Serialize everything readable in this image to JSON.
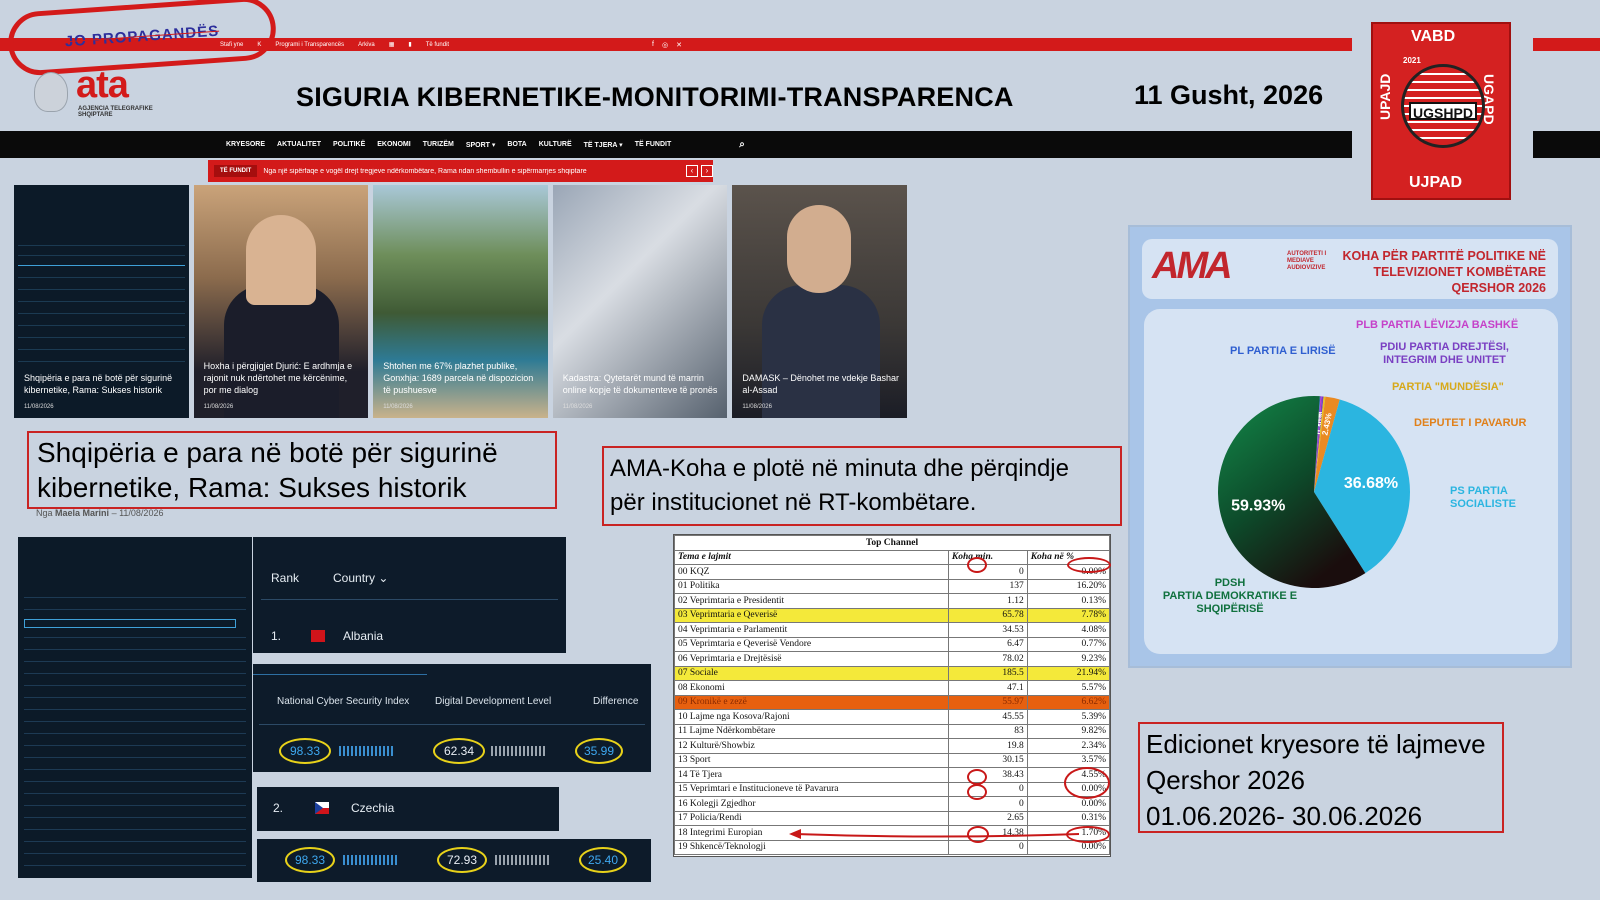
{
  "stamp": {
    "text": "JO PROPAGANDËS"
  },
  "site": {
    "logo_text": "ata",
    "logo_subtitle": "AGJENCIA TELEGRAFIKE SHQIPTARE",
    "top_links": [
      "Stafi yne",
      "K",
      "Programi i Transparencës",
      "Arkiva",
      "Të fundit"
    ],
    "social_icons": [
      "facebook-icon",
      "instagram-icon",
      "x-icon"
    ],
    "nav": [
      "KRYESORE",
      "AKTUALITET",
      "POLITIKË",
      "EKONOMI",
      "TURIZËM",
      "SPORT ▾",
      "BOTA",
      "KULTURË",
      "TË TJERA ▾",
      "TË FUNDIT"
    ],
    "ticker_tag": "TË FUNDIT",
    "ticker_text": "Nga një sipërfaqe e vogël drejt tregjeve ndërkombëtare, Rama ndan shembullin e sipërmarrjes shqiptare"
  },
  "headline": "SIGURIA KIBERNETIKE-MONITORIMI-TRANSPARENCA",
  "date": "11 Gusht, 2026",
  "badge": {
    "top": "VABD",
    "left": "UPAJD",
    "right": "UGAPD",
    "center": "UGSHPD",
    "bottom": "UJPAD",
    "year": "2021"
  },
  "cards": [
    {
      "caption": "Shqipëria e para në botë për sigurinë kibernetike, Rama: Sukses historik",
      "date": "11/08/2026"
    },
    {
      "caption": "Hoxha i përgjigjet Djurić: E ardhmja e rajonit nuk ndërtohet me kërcënime, por me dialog",
      "date": "11/08/2026"
    },
    {
      "caption": "Shtohen me 67% plazhet publike, Gonxhja: 1689 parcela në dispozicion të pushuesve",
      "date": "11/08/2026"
    },
    {
      "caption": "Kadastra: Qytetarët mund të marrin online kopje të dokumenteve të pronës",
      "date": "11/08/2026"
    },
    {
      "caption": "DAMASK – Dënohet me vdekje Bashar al-Assad",
      "date": "11/08/2026"
    }
  ],
  "article_title_line1": "Shqipëria e para në botë për sigurinë",
  "article_title_line2": "kibernetike, Rama: Sukses historik",
  "byline": {
    "prefix": "Nga",
    "author": "Maela Marini",
    "date": "11/08/2026"
  },
  "ama_note_line1": "AMA-Koha e plotë në minuta dhe përqindje",
  "ama_note_line2": "për institucionet në RT-kombëtare.",
  "editions_note": [
    "Edicionet kryesore të lajmeve",
    "Qershor 2026",
    "01.06.2026- 30.06.2026"
  ],
  "ranking": {
    "headers": [
      "Rank",
      "Country ⌄"
    ],
    "metrics": [
      "National Cyber Security Index",
      "Digital Development Level",
      "Difference"
    ],
    "rows": [
      {
        "rank": "1.",
        "country": "Albania",
        "ncsi": "98.33",
        "ddl": "62.34",
        "diff": "35.99"
      },
      {
        "rank": "2.",
        "country": "Czechia",
        "ncsi": "98.33",
        "ddl": "72.93",
        "diff": "25.40"
      }
    ]
  },
  "table": {
    "channel": "Top Channel",
    "headers": [
      "Tema e lajmit",
      "Koha min.",
      "Koha në %"
    ],
    "rows": [
      {
        "topic": "00 KQZ",
        "min": "0",
        "pct": "0.00%"
      },
      {
        "topic": "01 Politika",
        "min": "137",
        "pct": "16.20%"
      },
      {
        "topic": "02 Veprimtaria e Presidentit",
        "min": "1.12",
        "pct": "0.13%"
      },
      {
        "topic": "03 Veprimtaria e Qeverisë",
        "min": "65.78",
        "pct": "7.78%",
        "hl": "yel"
      },
      {
        "topic": "04 Veprimtaria e Parlamentit",
        "min": "34.53",
        "pct": "4.08%"
      },
      {
        "topic": "05 Veprimtaria e Qeverisë Vendore",
        "min": "6.47",
        "pct": "0.77%"
      },
      {
        "topic": "06 Veprimtaria e Drejtësisë",
        "min": "78.02",
        "pct": "9.23%"
      },
      {
        "topic": "07 Sociale",
        "min": "185.5",
        "pct": "21.94%",
        "hl": "yel"
      },
      {
        "topic": "08 Ekonomi",
        "min": "47.1",
        "pct": "5.57%"
      },
      {
        "topic": "09 Kronikë e zezë",
        "min": "55.97",
        "pct": "6.62%",
        "hl": "ora"
      },
      {
        "topic": "10 Lajme nga Kosova/Rajoni",
        "min": "45.55",
        "pct": "5.39%"
      },
      {
        "topic": "11 Lajme Ndërkombëtare",
        "min": "83",
        "pct": "9.82%"
      },
      {
        "topic": "12 Kulturë/Showbiz",
        "min": "19.8",
        "pct": "2.34%"
      },
      {
        "topic": "13 Sport",
        "min": "30.15",
        "pct": "3.57%"
      },
      {
        "topic": "14 Të Tjera",
        "min": "38.43",
        "pct": "4.55%"
      },
      {
        "topic": "15 Veprimtari e Institucioneve të Pavarura",
        "min": "0",
        "pct": "0.00%"
      },
      {
        "topic": "16 Kolegji Zgjedhor",
        "min": "0",
        "pct": "0.00%"
      },
      {
        "topic": "17 Policia/Rendi",
        "min": "2.65",
        "pct": "0.31%"
      },
      {
        "topic": "18 Integrimi Europian",
        "min": "14.38",
        "pct": "1.70%"
      },
      {
        "topic": "19 Shkencë/Teknologji",
        "min": "0",
        "pct": "0.00%"
      }
    ]
  },
  "ama": {
    "logo": "AMA",
    "logo_sub": [
      "AUTORITETI I",
      "MEDIAVE",
      "AUDIOVIZIVE"
    ],
    "title": [
      "KOHA PËR PARTITË POLITIKE NË",
      "TELEVIZIONET KOMBËTARE",
      "QERSHOR 2026"
    ],
    "labels": {
      "plb": "PLB  PARTIA LËVIZJA BASHKË",
      "pl": "PL PARTIA E LIRISË",
      "pdiu": [
        "PDIU PARTIA DREJTËSI,",
        "INTEGRIM DHE UNITET"
      ],
      "mund": "PARTIA \"MUNDËSIA\"",
      "dep": "DEPUTET I PAVARUR",
      "ps": [
        "PS PARTIA",
        "SOCIALISTE"
      ],
      "pd": [
        "PDSH",
        "PARTIA DEMOKRATIKE E",
        "SHQIPËRISË"
      ]
    }
  },
  "chart_data": {
    "type": "pie",
    "title": "KOHA PËR PARTITË POLITIKE NË TELEVIZIONET KOMBËTARE QERSHOR 2026",
    "slices": [
      {
        "name": "PS PARTIA SOCIALISTE",
        "value": 36.68,
        "color": "#2bb5e0",
        "label": "36.68%"
      },
      {
        "name": "PDSH PARTIA DEMOKRATIKE E SHQIPËRISË",
        "value": 59.93,
        "color": "#0f6e3c",
        "label": "59.93%"
      },
      {
        "name": "PL PARTIA E LIRISË",
        "value": 0.13,
        "color": "#3a66d6",
        "label": "0.13%"
      },
      {
        "name": "PLB  PARTIA LËVIZJA BASHKË",
        "value": 0.21,
        "color": "#b833c9",
        "label": "0.21%"
      },
      {
        "name": "PDIU PARTIA DREJTËSI, INTEGRIM DHE UNITET",
        "value": 0.3,
        "color": "#7a3fc2",
        "label": "0.30%"
      },
      {
        "name": "PARTIA \"MUNDËSIA\"",
        "value": 0.3,
        "color": "#e6c11f",
        "label": ""
      },
      {
        "name": "DEPUTET I PAVARUR",
        "value": 2.43,
        "color": "#ea8a22",
        "label": "2.43%"
      }
    ]
  }
}
